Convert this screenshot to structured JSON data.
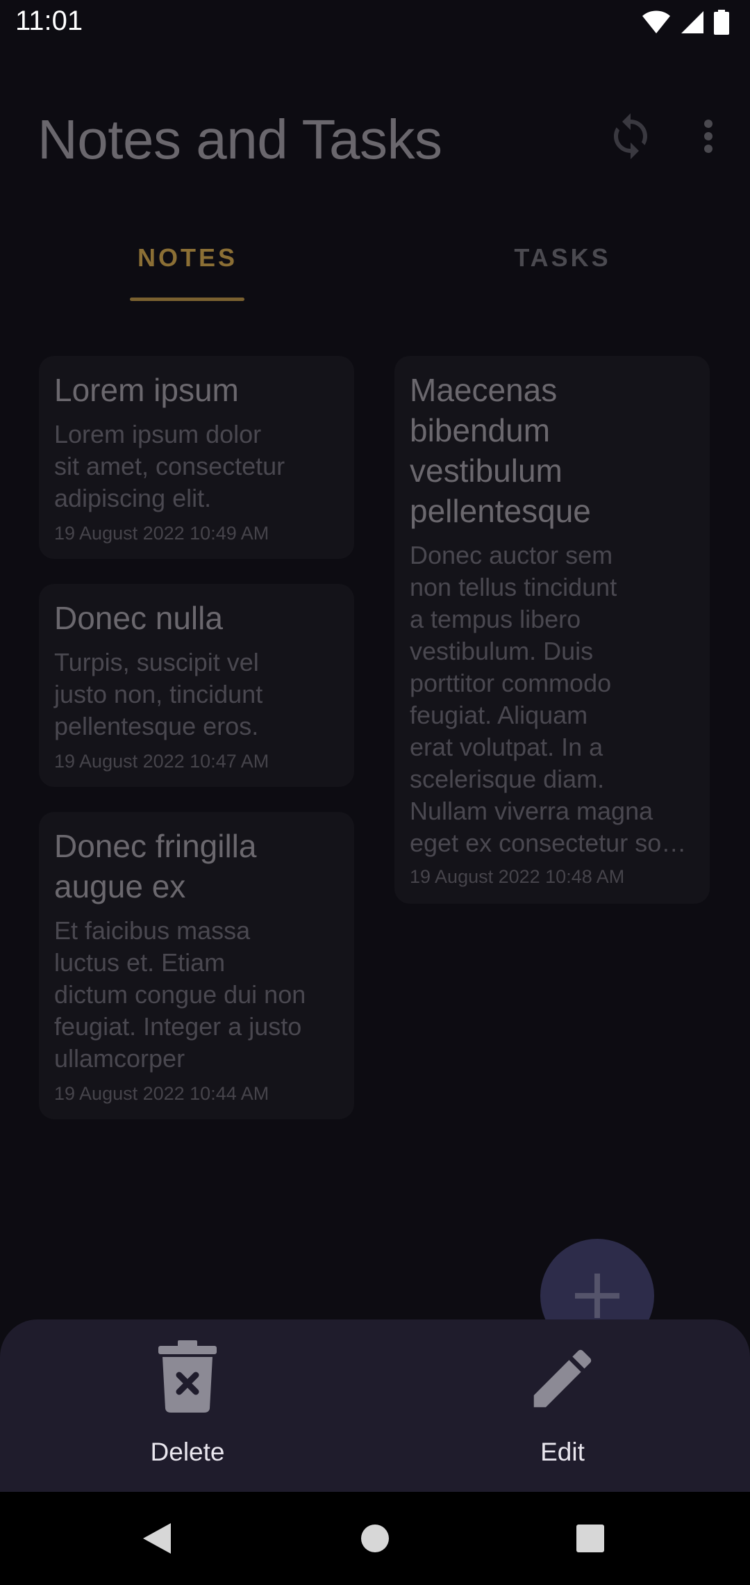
{
  "status_bar": {
    "time": "11:01",
    "icons": [
      "wifi-icon",
      "cellular-icon",
      "battery-icon"
    ]
  },
  "app_bar": {
    "title": "Notes and Tasks",
    "actions": [
      "sync-icon",
      "more-vert-icon"
    ]
  },
  "tabs": [
    {
      "label": "NOTES",
      "selected": true
    },
    {
      "label": "TASKS",
      "selected": false
    }
  ],
  "notes": [
    {
      "title": "Lorem ipsum",
      "body": [
        "Lorem ipsum dolor",
        "sit amet, consectetur",
        "adipiscing elit."
      ],
      "date": "19 August 2022 10:49 AM"
    },
    {
      "title": "Donec nulla",
      "body": [
        "Turpis, suscipit vel",
        "justo non, tincidunt",
        "pellentesque eros."
      ],
      "date": "19 August 2022 10:47 AM"
    },
    {
      "title": [
        "Donec fringilla",
        "augue ex"
      ],
      "body": [
        "Et faicibus massa",
        "luctus et. Etiam",
        "dictum congue dui non",
        "feugiat. Integer a justo",
        "ullamcorper"
      ],
      "date": "19 August 2022 10:44 AM"
    },
    {
      "title": [
        "Maecenas",
        "bibendum",
        "vestibulum",
        "pellentesque"
      ],
      "body": [
        "Donec auctor sem",
        "non tellus tincidunt",
        "a tempus libero",
        "vestibulum. Duis",
        "porttitor commodo",
        "feugiat. Aliquam",
        "erat volutpat. In a",
        "scelerisque diam.",
        "Nullam viverra magna",
        "eget ex consectetur so…"
      ],
      "date": "19 August 2022 10:48 AM"
    }
  ],
  "fab": {
    "icon": "plus-icon"
  },
  "bottom_sheet": {
    "actions": [
      {
        "label": "Delete",
        "icon": "delete-icon"
      },
      {
        "label": "Edit",
        "icon": "edit-icon"
      }
    ]
  },
  "nav_bar": {
    "buttons": [
      "back-icon",
      "home-icon",
      "recents-icon"
    ]
  },
  "colors": {
    "background": "#0d0c12",
    "accent": "#8b6f35",
    "sheet": "#1f1c2c",
    "card": "#141319"
  }
}
